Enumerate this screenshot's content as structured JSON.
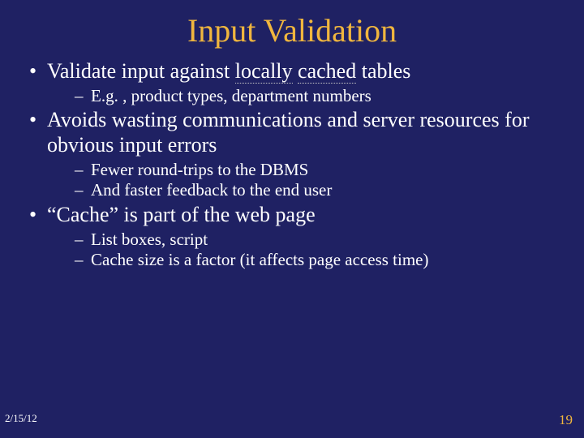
{
  "title": "Input Validation",
  "bullets": {
    "b1_pre": "Validate input against ",
    "b1_u1": "locally",
    "b1_sp": " ",
    "b1_u2": "cached",
    "b1_post": " tables",
    "b1s1": "E.g. , product types, department numbers",
    "b2": "Avoids wasting communications and server resources for obvious input errors",
    "b2s1": "Fewer round-trips to the DBMS",
    "b2s2": "And faster feedback to the end user",
    "b3": "“Cache” is part of the web page",
    "b3s1": "List boxes, script",
    "b3s2": "Cache size is a factor (it affects page access time)"
  },
  "footer": {
    "date": "2/15/12",
    "page": "19"
  }
}
